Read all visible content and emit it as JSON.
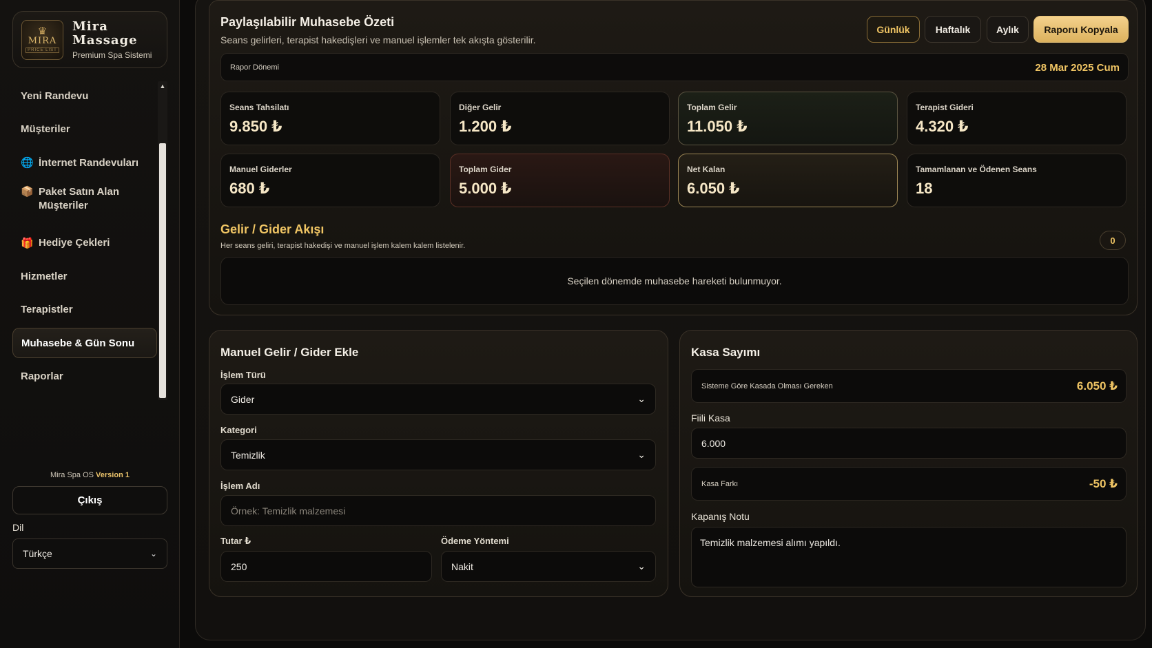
{
  "brand": {
    "logo_text": "MIRA",
    "logo_sub": "PRICE LIST",
    "name_line1": "Mira",
    "name_line2": "Massage",
    "subtitle": "Premium Spa Sistemi"
  },
  "nav": {
    "items": [
      {
        "label": "Yeni Randevu",
        "icon": ""
      },
      {
        "label": "Müşteriler",
        "icon": ""
      },
      {
        "label": "İnternet Randevuları",
        "icon": "globe-icon"
      },
      {
        "label": "Paket Satın Alan Müşteriler",
        "icon": "package-icon"
      },
      {
        "label": "Hediye Çekleri",
        "icon": "gift-icon"
      },
      {
        "label": "Hizmetler",
        "icon": ""
      },
      {
        "label": "Terapistler",
        "icon": ""
      },
      {
        "label": "Muhasebe & Gün Sonu",
        "icon": "",
        "active": true
      },
      {
        "label": "Raporlar",
        "icon": ""
      }
    ]
  },
  "footer": {
    "version_prefix": "Mira Spa OS",
    "version_value": "Version 1",
    "logout_label": "Çıkış",
    "language_label": "Dil",
    "language_value": "Türkçe"
  },
  "summary": {
    "title": "Paylaşılabilir Muhasebe Özeti",
    "subtitle": "Seans gelirleri, terapist hakedişleri ve manuel işlemler tek akışta gösterilir.",
    "buttons": {
      "daily": "Günlük",
      "weekly": "Haftalık",
      "monthly": "Aylık",
      "copy": "Raporu Kopyala"
    },
    "period_label": "Rapor Dönemi",
    "period_value": "28 Mar 2025 Cum",
    "stats": [
      {
        "label": "Seans Tahsilatı",
        "value": "9.850 ₺"
      },
      {
        "label": "Diğer Gelir",
        "value": "1.200 ₺"
      },
      {
        "label": "Toplam Gelir",
        "value": "11.050 ₺"
      },
      {
        "label": "Terapist Gideri",
        "value": "4.320 ₺"
      },
      {
        "label": "Manuel Giderler",
        "value": "680 ₺"
      },
      {
        "label": "Toplam Gider",
        "value": "5.000 ₺"
      },
      {
        "label": "Net Kalan",
        "value": "6.050 ₺"
      },
      {
        "label": "Tamamlanan ve Ödenen Seans",
        "value": "18"
      }
    ],
    "flow_title": "Gelir / Gider Akışı",
    "flow_subtitle": "Her seans geliri, terapist hakedişi ve manuel işlem kalem kalem listelenir.",
    "flow_count": "0",
    "empty_message": "Seçilen dönemde muhasebe hareketi bulunmuyor."
  },
  "manual": {
    "title": "Manuel Gelir / Gider Ekle",
    "type_label": "İşlem Türü",
    "type_value": "Gider",
    "category_label": "Kategori",
    "category_value": "Temizlik",
    "name_label": "İşlem Adı",
    "name_placeholder": "Örnek: Temizlik malzemesi",
    "amount_label": "Tutar ₺",
    "amount_value": "250",
    "payment_label": "Ödeme Yöntemi",
    "payment_value": "Nakit"
  },
  "kasa": {
    "title": "Kasa Sayımı",
    "expected_label": "Sisteme Göre Kasada Olması Gereken",
    "expected_value": "6.050 ₺",
    "actual_label": "Fiili Kasa",
    "actual_value": "6.000",
    "diff_label": "Kasa Farkı",
    "diff_value": "-50 ₺",
    "note_label": "Kapanış Notu",
    "note_value": "Temizlik malzemesi alımı yapıldı."
  },
  "colors": {
    "accent": "#f0c564",
    "background": "#0c0b0a"
  }
}
